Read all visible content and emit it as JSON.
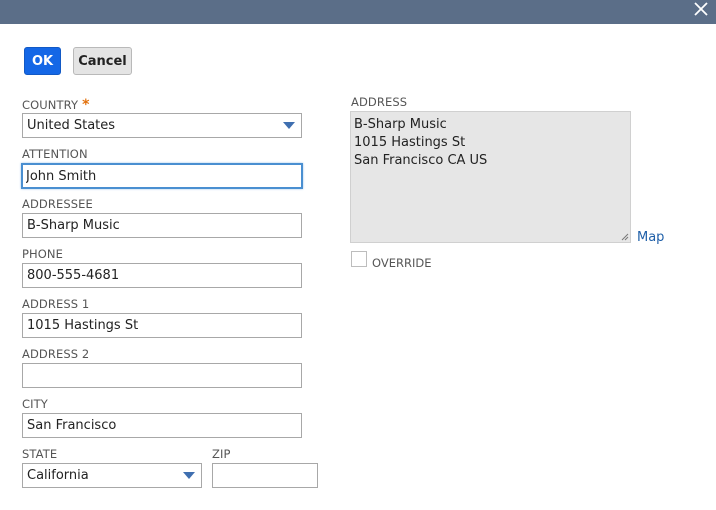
{
  "dialog": {
    "buttons": {
      "ok_label": "OK",
      "cancel_label": "Cancel"
    }
  },
  "form": {
    "country": {
      "label": "COUNTRY",
      "required_mark": "*",
      "value": "United States"
    },
    "attention": {
      "label": "ATTENTION",
      "value": "John Smith"
    },
    "addressee": {
      "label": "ADDRESSEE",
      "value": "B-Sharp Music"
    },
    "phone": {
      "label": "PHONE",
      "value": "800-555-4681"
    },
    "address1": {
      "label": "ADDRESS 1",
      "value": "1015 Hastings St"
    },
    "address2": {
      "label": "ADDRESS 2",
      "value": ""
    },
    "city": {
      "label": "CITY",
      "value": "San Francisco"
    },
    "state": {
      "label": "STATE",
      "value": "California"
    },
    "zip": {
      "label": "ZIP",
      "value": ""
    }
  },
  "address_panel": {
    "label": "ADDRESS",
    "lines": [
      "B-Sharp Music",
      "1015 Hastings St",
      "San Francisco CA US"
    ],
    "map_label": "Map",
    "override_label": "OVERRIDE",
    "override_checked": false
  },
  "icons": {
    "close": "close-icon",
    "dropdown": "chevron-down-icon",
    "resize": "resize-grip-icon"
  },
  "colors": {
    "titlebar": "#5b6e88",
    "primary_button": "#1467e6",
    "required": "#e2700b",
    "link": "#1f5fa8",
    "focus": "#4a8fd1"
  }
}
